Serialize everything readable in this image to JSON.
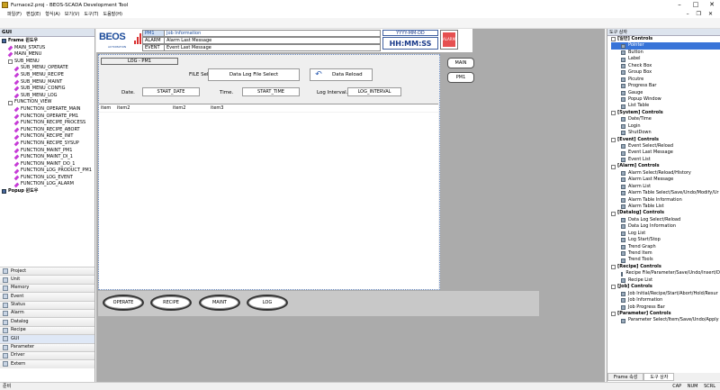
{
  "window": {
    "title": "Furnace2.proj - BEOS-SCADA Development Tool"
  },
  "menu": [
    "파일(F)",
    "편집(E)",
    "형식(A)",
    "보기(V)",
    "도구(T)",
    "도움말(H)"
  ],
  "left_panel": {
    "title": "GUI",
    "tree": [
      {
        "label": "Frame 윈도우",
        "level": 0,
        "icon": "grid",
        "bold": true
      },
      {
        "label": "MAIN_STATUS",
        "level": 1,
        "icon": "pen"
      },
      {
        "label": "MAIN_MENU",
        "level": 1,
        "icon": "pen"
      },
      {
        "label": "SUB_MENU",
        "level": 1,
        "icon": "minus"
      },
      {
        "label": "SUB_MENU_OPERATE",
        "level": 2,
        "icon": "pen"
      },
      {
        "label": "SUB_MENU_RECIPE",
        "level": 2,
        "icon": "pen"
      },
      {
        "label": "SUB_MENU_MAINT",
        "level": 2,
        "icon": "pen"
      },
      {
        "label": "SUB_MENU_CONFIG",
        "level": 2,
        "icon": "pen"
      },
      {
        "label": "SUB_MENU_LOG",
        "level": 2,
        "icon": "pen"
      },
      {
        "label": "FUNCTION_VIEW",
        "level": 1,
        "icon": "minus"
      },
      {
        "label": "FUNCTION_OPERATE_MAIN",
        "level": 2,
        "icon": "pen"
      },
      {
        "label": "FUNCTION_OPERATE_PM1",
        "level": 2,
        "icon": "pen"
      },
      {
        "label": "FUNCTION_RECIPE_PROCESS",
        "level": 2,
        "icon": "pen"
      },
      {
        "label": "FUNCTION_RECIPE_ABORT",
        "level": 2,
        "icon": "pen"
      },
      {
        "label": "FUNCTION_RECIPE_INIT",
        "level": 2,
        "icon": "pen"
      },
      {
        "label": "FUNCTION_RECIPE_SYSUP",
        "level": 2,
        "icon": "pen"
      },
      {
        "label": "FUNCTION_MAINT_PM1",
        "level": 2,
        "icon": "pen"
      },
      {
        "label": "FUNCTION_MAINT_DI_1",
        "level": 2,
        "icon": "pen"
      },
      {
        "label": "FUNCTION_MAINT_DO_1",
        "level": 2,
        "icon": "pen"
      },
      {
        "label": "FUNCTION_LOG_PRODUCT_PM1",
        "level": 2,
        "icon": "pen"
      },
      {
        "label": "FUNCTION_LOG_EVENT",
        "level": 2,
        "icon": "pen"
      },
      {
        "label": "FUNCTION_LOG_ALARM",
        "level": 2,
        "icon": "pen"
      },
      {
        "label": "Popup 윈도우",
        "level": 0,
        "icon": "grid",
        "bold": true
      }
    ],
    "categories": [
      "Project",
      "Unit",
      "Memory",
      "Event",
      "Status",
      "Alarm",
      "Datalog",
      "Recipe",
      "GUI",
      "Parameter",
      "Driver",
      "Extern"
    ],
    "selected_category": "GUI"
  },
  "header": {
    "logo_text": "BEOS",
    "logo_sub": "AUTOMATION",
    "rows": [
      {
        "key": "PM1",
        "value": "Job Information"
      },
      {
        "key": "ALARM",
        "value": "Alarm Last Message"
      },
      {
        "key": "EVENT",
        "value": "Event Last Message"
      }
    ],
    "date": "YYYY-MM-DD",
    "time": "HH:MM:SS",
    "alarm_button": "ALARM"
  },
  "log_panel": {
    "title": "LOG - PM1",
    "file_select_label": "FILE Select",
    "data_log_file_select": "Data Log File Select",
    "data_reload": "Data Reload",
    "date_label": "Date.",
    "start_date": "START_DATE",
    "time_label": "Time.",
    "start_time": "START_TIME",
    "log_interval_label": "Log Interval.",
    "log_interval": "LOG_INTERVAL",
    "list_row": [
      "item",
      "item2",
      "item2",
      "item3"
    ]
  },
  "side_buttons": [
    "MAIN",
    "PM1"
  ],
  "bottom_buttons": [
    "OPERATE",
    "RECIPE",
    "MAINT",
    "LOG"
  ],
  "right_panel": {
    "title": "도구 상자",
    "groups": [
      {
        "name": "[일반] Controls",
        "items": [
          "Pointer",
          "Button",
          "Label",
          "Check Box",
          "Group Box",
          "Picutre",
          "Progress Bar",
          "Gauge",
          "Popup Window",
          "List Table"
        ]
      },
      {
        "name": "[System] Controls",
        "items": [
          "Date/Time",
          "Login",
          "ShutDown"
        ]
      },
      {
        "name": "[Event] Controls",
        "items": [
          "Event Select/Reload",
          "Event Last Message",
          "Event List"
        ]
      },
      {
        "name": "[Alarm] Controls",
        "items": [
          "Alarm Select/Reload/History",
          "Alarm Last Message",
          "Alarm List",
          "Alarm Table Select/Save/Undo/Modify/Ur",
          "Alarm Table Information",
          "Alarm Table List"
        ]
      },
      {
        "name": "[Datalog] Controls",
        "items": [
          "Data Log Select/Reload",
          "Data Log Information",
          "Log List",
          "Log Start/Stop",
          "Trend Graph",
          "Trend Item",
          "Trend Tools"
        ]
      },
      {
        "name": "[Recipe] Controls",
        "items": [
          "Recipe File/Parameter/Save/Undo/Insert/D",
          "Recipe List"
        ]
      },
      {
        "name": "[Job] Controls",
        "items": [
          "Job Initial/Recipe/Start/Abort/Hold/Resur",
          "Job Information",
          "Job Progress Bar"
        ]
      },
      {
        "name": "[Parameter] Controls",
        "items": [
          "Parameter Select/Item/Save/Undo/Apply"
        ]
      }
    ],
    "selected_item": "Pointer",
    "tabs": [
      "Frame 속성",
      "도구 상자"
    ],
    "active_tab": "도구 상자"
  },
  "statusbar": {
    "left": "준비",
    "indicators": [
      "CAP",
      "NUM",
      "SCRL"
    ]
  },
  "colors": {
    "brand": "#1a4a9a",
    "selection": "#3874d8",
    "alarm": "#e65050",
    "workspace": "#ababab"
  }
}
